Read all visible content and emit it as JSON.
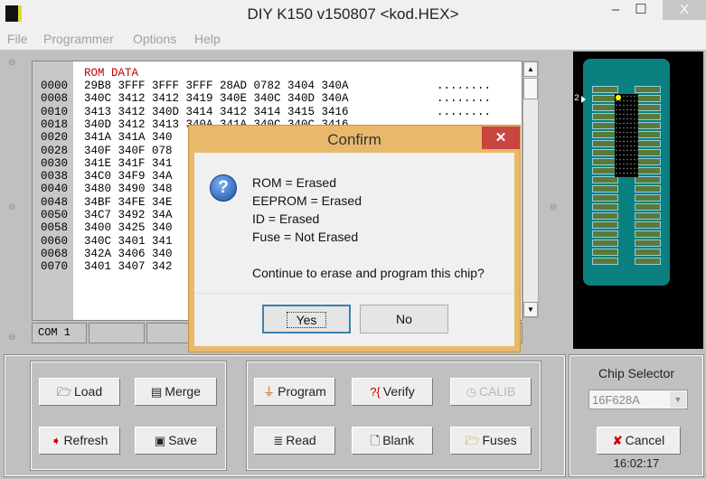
{
  "window": {
    "title": "DIY K150 v150807  <kod.HEX>",
    "minimize": "–",
    "maximize": "☐",
    "close": "X"
  },
  "menu": [
    "File",
    "Programmer",
    "Options",
    "Help"
  ],
  "hex": {
    "header": "ROM DATA",
    "rows": [
      {
        "addr": "0000",
        "data": "29B8 3FFF 3FFF 3FFF 28AD 0782 3404 340A",
        "ascii": "........"
      },
      {
        "addr": "0008",
        "data": "340C 3412 3412 3419 340E 340C 340D 340A",
        "ascii": "........"
      },
      {
        "addr": "0010",
        "data": "3413 3412 340D 3414 3412 3414 3415 3416",
        "ascii": "........"
      },
      {
        "addr": "0018",
        "data": "340D 3412 3413 340A 341A 340C 340C 3416",
        "ascii": ""
      },
      {
        "addr": "0020",
        "data": "341A 341A 340",
        "ascii": ""
      },
      {
        "addr": "0028",
        "data": "340F 340F 078",
        "ascii": ""
      },
      {
        "addr": "0030",
        "data": "341E 341F 341",
        "ascii": ""
      },
      {
        "addr": "0038",
        "data": "34C0 34F9 34A",
        "ascii": ""
      },
      {
        "addr": "0040",
        "data": "3480 3490 348",
        "ascii": ""
      },
      {
        "addr": "0048",
        "data": "34BF 34FE 34E",
        "ascii": ""
      },
      {
        "addr": "0050",
        "data": "34C7 3492 34A",
        "ascii": ""
      },
      {
        "addr": "0058",
        "data": "3400 3425 340",
        "ascii": ""
      },
      {
        "addr": "0060",
        "data": "340C 3401 341",
        "ascii": ""
      },
      {
        "addr": "0068",
        "data": "342A 3406 340",
        "ascii": ""
      },
      {
        "addr": "0070",
        "data": "3401 3407 342",
        "ascii": ""
      }
    ]
  },
  "status": {
    "port": "COM 1"
  },
  "chip_view": {
    "pin_label": "2"
  },
  "buttons": {
    "load": "Load",
    "merge": "Merge",
    "refresh": "Refresh",
    "save": "Save",
    "program": "Program",
    "verify": "Verify",
    "calib": "CALIB",
    "read": "Read",
    "blank": "Blank",
    "fuses": "Fuses",
    "cancel": "Cancel"
  },
  "chip_selector": {
    "label": "Chip Selector",
    "value": "16F628A"
  },
  "clock": "16:02:17",
  "dialog": {
    "title": "Confirm",
    "close": "✕",
    "lines": [
      "ROM = Erased",
      "EEPROM = Erased",
      "ID = Erased",
      "Fuse = Not Erased"
    ],
    "question": "Continue to erase and program this chip?",
    "yes": "Yes",
    "no": "No"
  },
  "colors": {
    "hex_header": "#c00000",
    "board": "#0a8080",
    "dialog_frame": "#e9b96b",
    "close_red": "#c94540"
  }
}
